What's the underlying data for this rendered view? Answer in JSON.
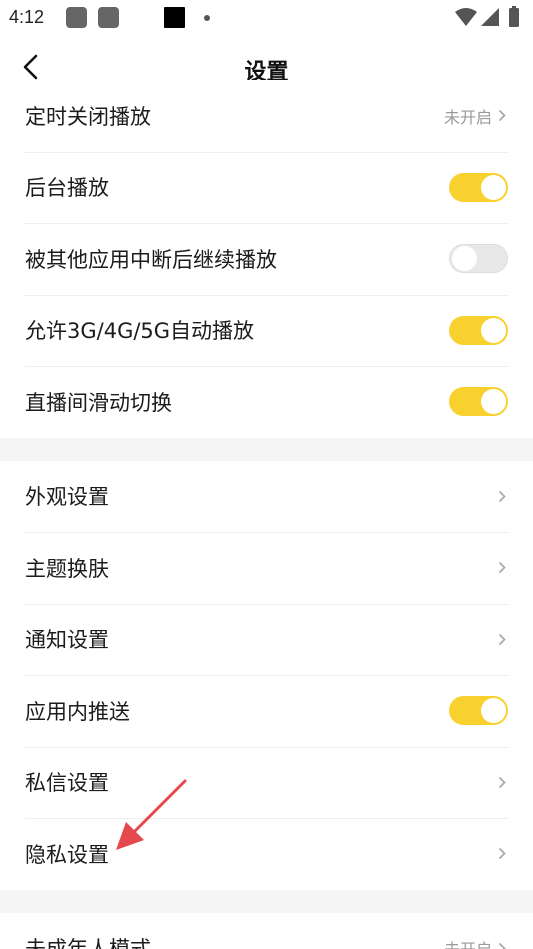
{
  "status_bar": {
    "time": "4:12"
  },
  "header": {
    "title": "设置"
  },
  "group1": {
    "items": [
      {
        "label": "定时关闭播放",
        "value": "未开启",
        "type": "link"
      },
      {
        "label": "后台播放",
        "type": "toggle",
        "on": true
      },
      {
        "label": "被其他应用中断后继续播放",
        "type": "toggle",
        "on": false
      },
      {
        "label": "允许3G/4G/5G自动播放",
        "type": "toggle",
        "on": true
      },
      {
        "label": "直播间滑动切换",
        "type": "toggle",
        "on": true
      }
    ]
  },
  "group2": {
    "items": [
      {
        "label": "外观设置",
        "type": "link"
      },
      {
        "label": "主题换肤",
        "type": "link"
      },
      {
        "label": "通知设置",
        "type": "link"
      },
      {
        "label": "应用内推送",
        "type": "toggle",
        "on": true
      },
      {
        "label": "私信设置",
        "type": "link"
      },
      {
        "label": "隐私设置",
        "type": "link"
      }
    ]
  },
  "group3": {
    "items": [
      {
        "label": "未成年人模式",
        "value": "未开启",
        "type": "link"
      }
    ]
  },
  "colors": {
    "accent": "#f8d12f",
    "annotation_arrow": "#e5484d",
    "separator": "#f5f5f5"
  }
}
